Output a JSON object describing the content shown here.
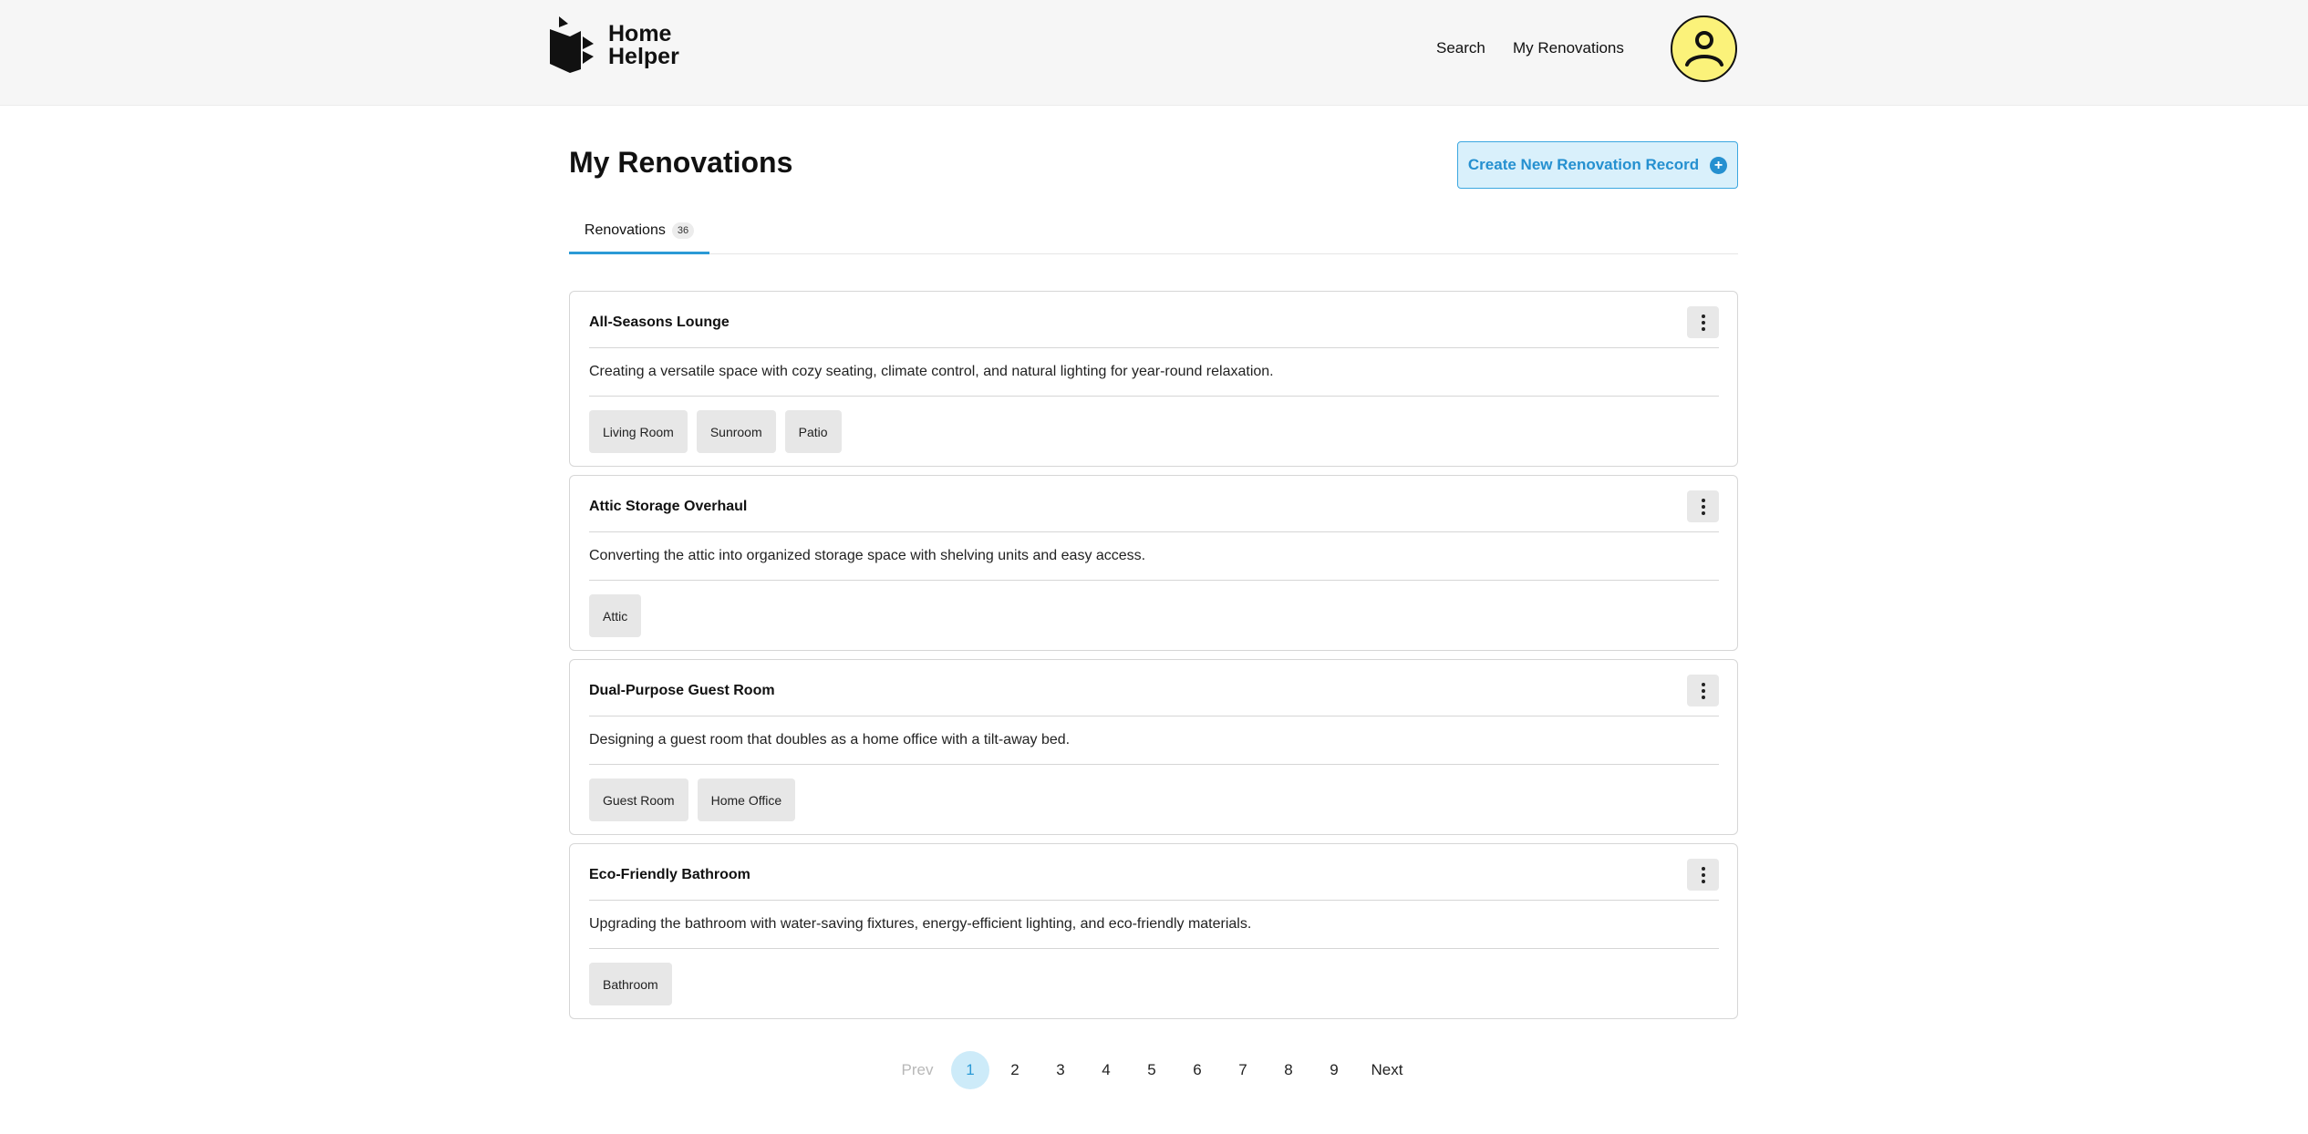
{
  "header": {
    "brand_line1": "Home",
    "brand_line2": "Helper",
    "nav": [
      {
        "label": "Search"
      },
      {
        "label": "My Renovations"
      }
    ]
  },
  "main": {
    "title": "My Renovations",
    "create_button_label": "Create New Renovation Record",
    "tab": {
      "label": "Renovations",
      "count": "36"
    }
  },
  "renovations": [
    {
      "title": "All-Seasons Lounge",
      "description": "Creating a versatile space with cozy seating, climate control, and natural lighting for year-round relaxation.",
      "tags": [
        "Living Room",
        "Sunroom",
        "Patio"
      ]
    },
    {
      "title": "Attic Storage Overhaul",
      "description": "Converting the attic into organized storage space with shelving units and easy access.",
      "tags": [
        "Attic"
      ]
    },
    {
      "title": "Dual-Purpose Guest Room",
      "description": "Designing a guest room that doubles as a home office with a tilt-away bed.",
      "tags": [
        "Guest Room",
        "Home Office"
      ]
    },
    {
      "title": "Eco-Friendly Bathroom",
      "description": "Upgrading the bathroom with water-saving fixtures, energy-efficient lighting, and eco-friendly materials.",
      "tags": [
        "Bathroom"
      ]
    }
  ],
  "pagination": {
    "prev_label": "Prev",
    "next_label": "Next",
    "pages": [
      "1",
      "2",
      "3",
      "4",
      "5",
      "6",
      "7",
      "8",
      "9"
    ],
    "current_page": "1"
  },
  "colors": {
    "accent": "#2b9ad6",
    "avatar_bg": "#fbf27a",
    "header_bg": "#f6f6f6"
  }
}
